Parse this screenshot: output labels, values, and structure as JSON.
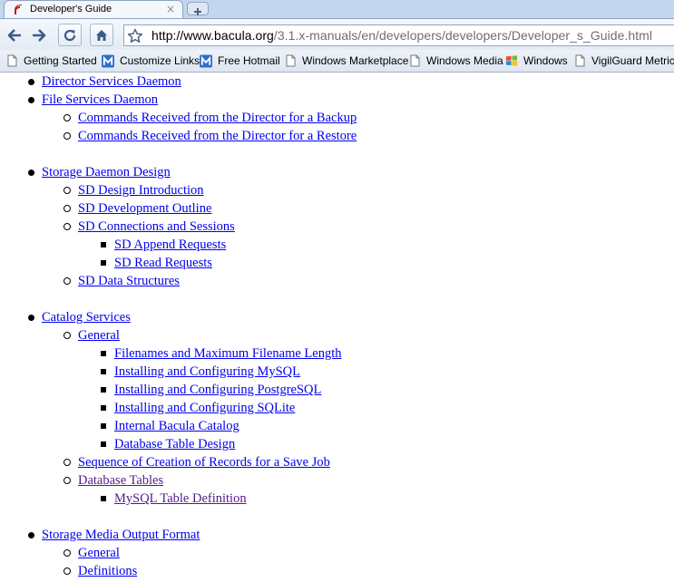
{
  "tab": {
    "title": "Developer's Guide",
    "close": "×"
  },
  "toolbar": {
    "url_host": "http://www.bacula.org",
    "url_path": "/3.1.x-manuals/en/developers/developers/Developer_s_Guide.html"
  },
  "bookmarks": [
    {
      "label": "Getting Started",
      "icon": "page-icon"
    },
    {
      "label": "Customize Links",
      "icon": "msn-icon"
    },
    {
      "label": "Free Hotmail",
      "icon": "msn-icon"
    },
    {
      "label": "Windows Marketplace",
      "icon": "page-icon"
    },
    {
      "label": "Windows Media",
      "icon": "page-icon"
    },
    {
      "label": "Windows",
      "icon": "windows-flag-icon"
    },
    {
      "label": "VigilGuard Metrics",
      "icon": "page-icon"
    }
  ],
  "toc": {
    "director_services_daemon": "Director Services Daemon",
    "file_services_daemon": "File Services Daemon",
    "commands_backup": "Commands Received from the Director for a Backup",
    "commands_restore": "Commands Received from the Director for a Restore",
    "storage_daemon_design": "Storage Daemon Design",
    "sd_design_intro": "SD Design Introduction",
    "sd_dev_outline": "SD Development Outline",
    "sd_connections": "SD Connections and Sessions",
    "sd_append": "SD Append Requests",
    "sd_read": "SD Read Requests",
    "sd_data_structures": "SD Data Structures",
    "catalog_services": "Catalog Services",
    "general": "General",
    "filenames": "Filenames and Maximum Filename Length",
    "install_mysql": "Installing and Configuring MySQL",
    "install_postgresql": "Installing and Configuring PostgreSQL",
    "install_sqlite": "Installing and Configuring SQLite",
    "internal_catalog": "Internal Bacula Catalog",
    "db_table_design": "Database Table Design",
    "sequence_creation": "Sequence of Creation of Records for a Save Job",
    "database_tables": "Database Tables",
    "mysql_table_def": "MySQL Table Definition",
    "storage_media_output": "Storage Media Output Format",
    "general_2": "General",
    "definitions": "Definitions"
  }
}
